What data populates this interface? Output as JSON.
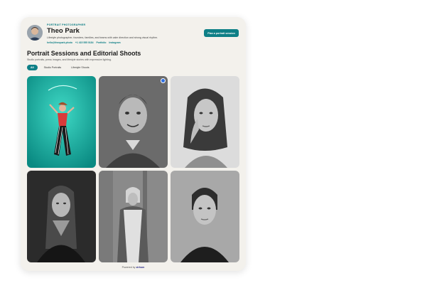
{
  "profile": {
    "role": "PORTRAIT PHOTOGRAPHER",
    "name": "Theo Park",
    "bio": "Lifestyle photographer, founders, families, and teams with calm direction and strong visual rhythm.",
    "links": [
      "hello@theopark.photo",
      "+1 415 555 0184",
      "Portfolio",
      "Instagram"
    ]
  },
  "actions": {
    "plan_label": "Plan a portrait session"
  },
  "page": {
    "title": "Portrait Sessions and Editorial Shoots",
    "subtitle": "Studio portraits, press images, and lifestyle stories with expressive lighting."
  },
  "tabs": [
    {
      "label": "All",
      "active": true
    },
    {
      "label": "Studio Portraits",
      "active": false
    },
    {
      "label": "Lifestyle Shoots",
      "active": false
    }
  ],
  "footer": {
    "prefix": "Powered by",
    "brand": "zirhom"
  },
  "colors": {
    "accent": "#0e7f86",
    "card_bg": "#f3f1ec",
    "badge": "#2f6fe0"
  }
}
